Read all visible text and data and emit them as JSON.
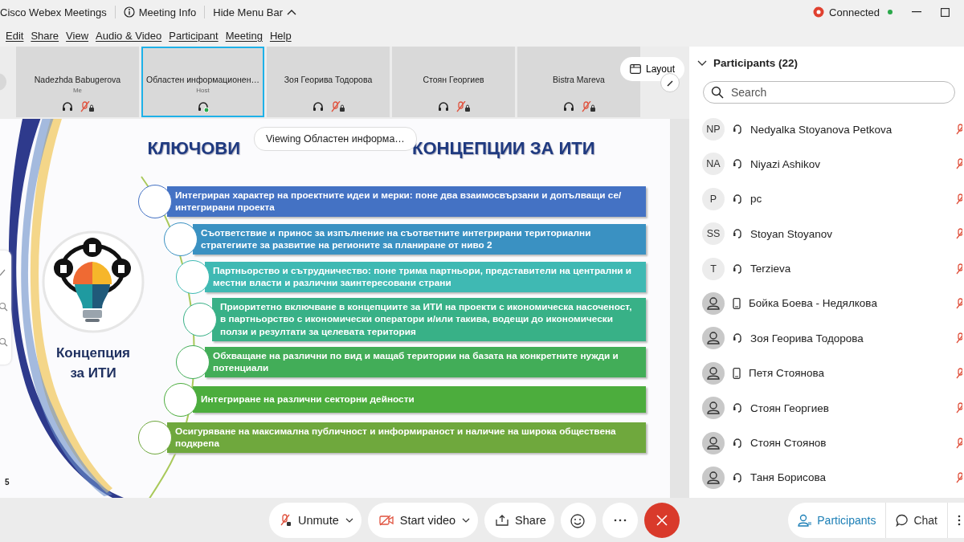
{
  "app_bar": {
    "app_name": "Cisco Webex Meetings",
    "meeting_info": "Meeting Info",
    "hide_menu": "Hide Menu Bar",
    "status": "Connected"
  },
  "menu": [
    "Edit",
    "Share",
    "View",
    "Audio & Video",
    "Participant",
    "Meeting",
    "Help"
  ],
  "tiles": [
    {
      "name": "Nadezhda Babugerova",
      "role": "Me",
      "selected": false,
      "video_off": true,
      "speaking": false
    },
    {
      "name": "Областен информационен…",
      "role": "Host",
      "selected": true,
      "video_off": false,
      "speaking": true
    },
    {
      "name": "Зоя Георива Тодорова",
      "selected": false,
      "video_off": true,
      "speaking": false
    },
    {
      "name": "Стоян Георгиев",
      "selected": false,
      "video_off": true,
      "speaking": false
    },
    {
      "name": "Bistra Mareva",
      "selected": false,
      "video_off": true,
      "speaking": false
    }
  ],
  "layout_button": "Layout",
  "viewing_tooltip": "Viewing Областен информа…",
  "slide": {
    "title_parts": [
      "КЛЮЧОВИ",
      "КОНЦЕПЦИИ ЗА ИТИ"
    ],
    "caption": "Концепция за ИТИ",
    "page": "5",
    "items": [
      {
        "text": "Интегриран характер на проектните идеи и мерки: поне два взаимосвързани и допълващи се/интегрирани проекта",
        "color": "#4472c4"
      },
      {
        "text": "Съответствие и принос за изпълнение на съответните интегрирани териториални стратегиите за развитие на регионите за планиране от ниво 2",
        "color": "#3a91c2"
      },
      {
        "text": "Партньорство и сътрудничество: поне трима партньори, представители на централни и местни власти и различни заинтересовани страни",
        "color": "#3fb9b3"
      },
      {
        "text": "Приоритетно включване в концепциите за ИТИ на проекти с икономическа насоченост, в партньорство с икономически оператори и/или такива, водещи до икономически ползи и резултати за целевата територия",
        "color": "#38b187"
      },
      {
        "text": "Обхващане на различни по вид и мащаб територии на базата на конкретните нужди и потенциали",
        "color": "#42ad58"
      },
      {
        "text": "Интегриране на различни секторни дейности",
        "color": "#4cad3d"
      },
      {
        "text": "Осигуряване на максимална публичност и информираност и наличие на широка обществена подкрепа",
        "color": "#6fa83d"
      }
    ]
  },
  "participants": {
    "title": "Participants (22)",
    "expanded": true,
    "search_placeholder": "Search",
    "people": [
      {
        "initials": "NP",
        "name": "Nedyalka Stoyanova Petkova",
        "kind": "headset"
      },
      {
        "initials": "NA",
        "name": "Niyazi Ashikov",
        "kind": "headset"
      },
      {
        "initials": "P",
        "name": "pc",
        "kind": "headset"
      },
      {
        "initials": "SS",
        "name": "Stoyan Stoyanov",
        "kind": "headset"
      },
      {
        "initials": "T",
        "name": "Terzieva",
        "kind": "headset"
      },
      {
        "name": "Бойка Боева - Недялкова",
        "kind": "phone"
      },
      {
        "name": "Зоя Георива Тодорова",
        "kind": "headset"
      },
      {
        "name": "Петя Стоянова",
        "kind": "phone"
      },
      {
        "name": "Стоян Георгиев",
        "kind": "headset"
      },
      {
        "name": "Стоян Стоянов",
        "kind": "headset"
      },
      {
        "name": "Таня Борисова",
        "kind": "headset"
      }
    ]
  },
  "controls": {
    "unmute": "Unmute",
    "start_video": "Start video",
    "share": "Share"
  },
  "side_tabs": [
    {
      "label": "Participants",
      "selected": true
    },
    {
      "label": "Chat",
      "selected": false
    }
  ]
}
